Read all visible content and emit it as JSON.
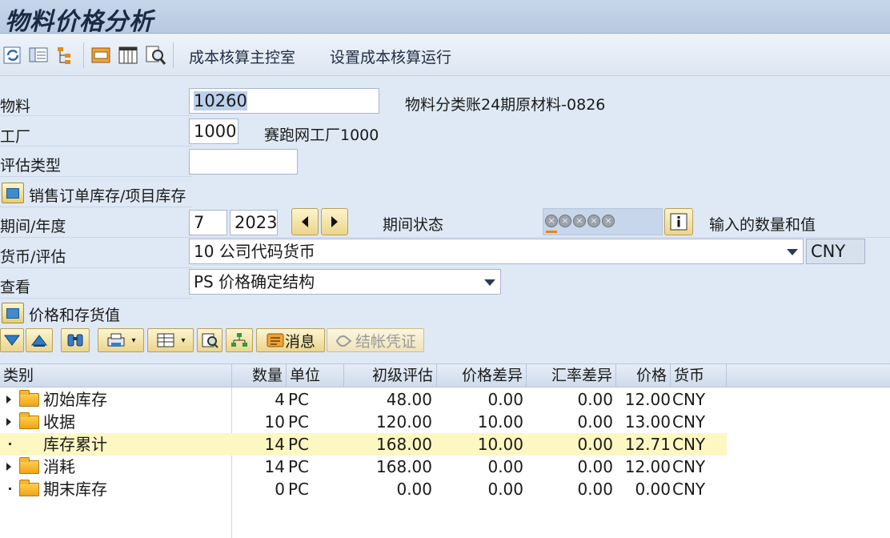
{
  "window": {
    "title": "物料价格分析"
  },
  "toolbar": {
    "cost_cockpit": "成本核算主控室",
    "set_costing_run": "设置成本核算运行"
  },
  "form": {
    "material_label": "物料",
    "material_value": "10260",
    "material_desc": "物料分类账24期原材料-0826",
    "plant_label": "工厂",
    "plant_value": "1000",
    "plant_desc": "赛跑网工厂1000",
    "valuation_type_label": "评估类型",
    "valuation_type_value": "",
    "sales_order_section": "销售订单库存/项目库存",
    "period_label": "期间/年度",
    "period_value": "7",
    "year_value": "2023",
    "period_status_label": "期间状态",
    "period_status_text": "输入的数量和值",
    "currency_label": "货币/评估",
    "currency_value": "10 公司代码货币",
    "currency_code": "CNY",
    "view_label": "查看",
    "view_value": "PS 价格确定结构",
    "price_section": "价格和存货值"
  },
  "alv": {
    "message_button": "消息",
    "posting_doc_button": "结帐凭证"
  },
  "grid": {
    "headers": [
      "类别",
      "数量",
      "单位",
      "初级评估",
      "价格差异",
      "汇率差异",
      "价格",
      "货币"
    ],
    "rows": [
      {
        "category": "初始库存",
        "qty": "4",
        "unit": "PC",
        "prelim": "48.00",
        "price_diff": "0.00",
        "fx_diff": "0.00",
        "price": "12.00",
        "currency": "CNY"
      },
      {
        "category": "收据",
        "qty": "10",
        "unit": "PC",
        "prelim": "120.00",
        "price_diff": "10.00",
        "fx_diff": "0.00",
        "price": "13.00",
        "currency": "CNY"
      },
      {
        "category": "库存累计",
        "qty": "14",
        "unit": "PC",
        "prelim": "168.00",
        "price_diff": "10.00",
        "fx_diff": "0.00",
        "price": "12.71",
        "currency": "CNY"
      },
      {
        "category": "消耗",
        "qty": "14",
        "unit": "PC",
        "prelim": "168.00",
        "price_diff": "0.00",
        "fx_diff": "0.00",
        "price": "12.00",
        "currency": "CNY"
      },
      {
        "category": "期末库存",
        "qty": "0",
        "unit": "PC",
        "prelim": "0.00",
        "price_diff": "0.00",
        "fx_diff": "0.00",
        "price": "0.00",
        "currency": "CNY"
      }
    ]
  },
  "colors": {
    "highlight_row": "#fdf7c2",
    "background": "#dfe9f5",
    "title_bar": "#c7d6ea"
  }
}
